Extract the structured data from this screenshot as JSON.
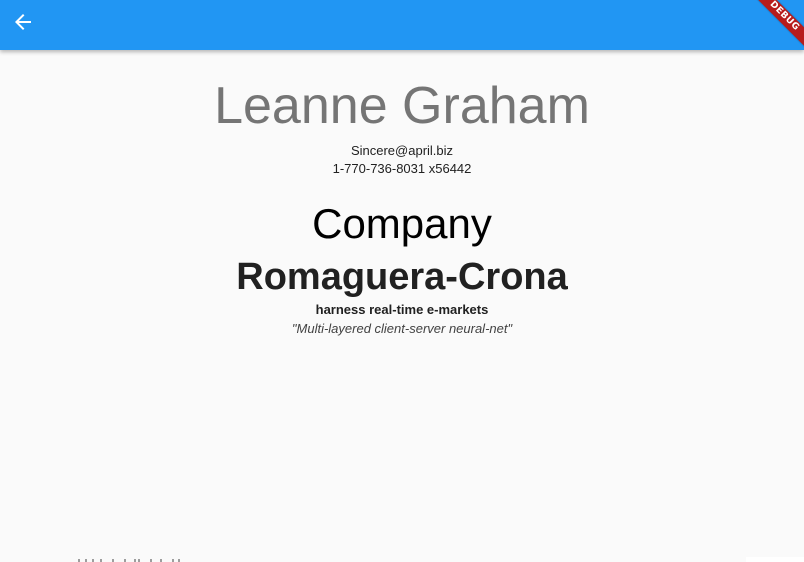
{
  "appbar": {
    "back_icon": "arrow-back-icon",
    "background_color": "#2196f3"
  },
  "debug_banner": {
    "label": "DEBUG",
    "color": "#b71c1c"
  },
  "user": {
    "name": "Leanne Graham",
    "email": "Sincere@april.biz",
    "phone": "1-770-736-8031 x56442"
  },
  "company": {
    "heading": "Company",
    "name": "Romaguera-Crona",
    "bs": "harness real-time e-markets",
    "catch_phrase": "\"Multi-layered client-server neural-net\""
  }
}
